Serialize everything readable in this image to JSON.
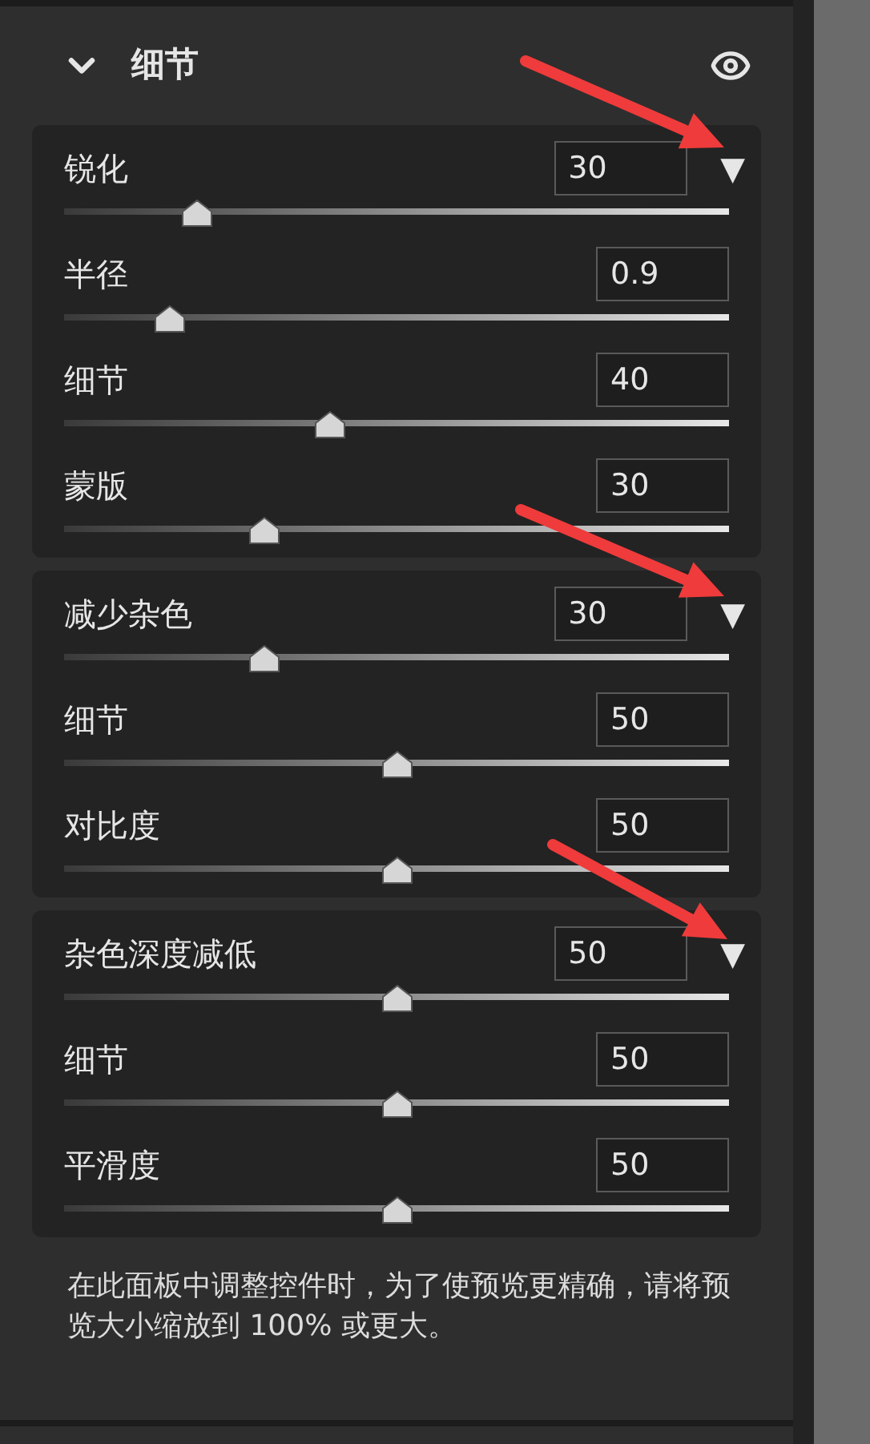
{
  "header": {
    "title": "细节",
    "expanded": true
  },
  "groups": [
    {
      "rows": [
        {
          "kind": "main",
          "label": "锐化",
          "value": "30",
          "level": 0.2,
          "menu": "▼"
        },
        {
          "kind": "sub",
          "label": "半径",
          "value": "0.9",
          "level": 0.16
        },
        {
          "kind": "sub",
          "label": "细节",
          "value": "40",
          "level": 0.4
        },
        {
          "kind": "sub",
          "label": "蒙版",
          "value": "30",
          "level": 0.3
        }
      ]
    },
    {
      "rows": [
        {
          "kind": "main",
          "label": "减少杂色",
          "value": "30",
          "level": 0.3,
          "menu": "▼"
        },
        {
          "kind": "sub",
          "label": "细节",
          "value": "50",
          "level": 0.5
        },
        {
          "kind": "sub",
          "label": "对比度",
          "value": "50",
          "level": 0.5
        }
      ]
    },
    {
      "rows": [
        {
          "kind": "main",
          "label": "杂色深度减低",
          "value": "50",
          "level": 0.5,
          "menu": "▼"
        },
        {
          "kind": "sub",
          "label": "细节",
          "value": "50",
          "level": 0.5
        },
        {
          "kind": "sub",
          "label": "平滑度",
          "value": "50",
          "level": 0.5
        }
      ]
    }
  ],
  "note": "在此面板中调整控件时，为了使预览更精确，请将预览大小缩放到 100% 或更大。"
}
